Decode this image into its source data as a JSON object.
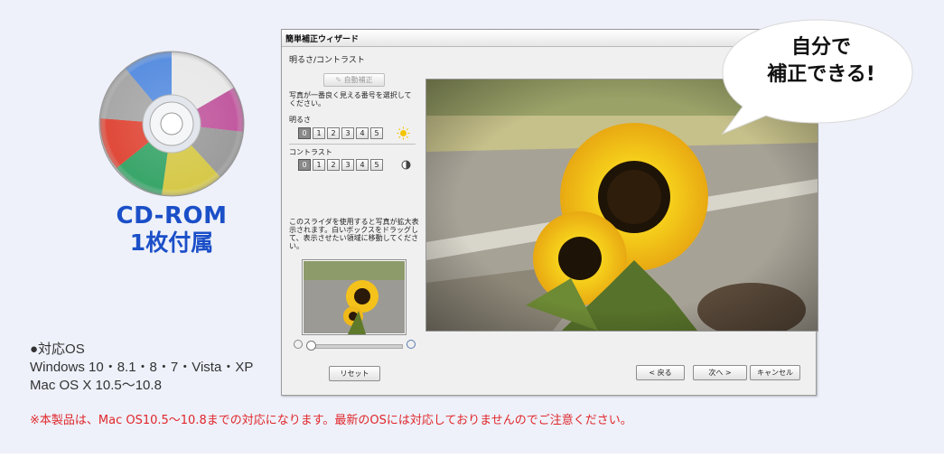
{
  "cd": {
    "line1": "CD-ROM",
    "line2": "1枚付属"
  },
  "os_info": {
    "heading": "●対応OS",
    "windows": "Windows 10・8.1・8・7・Vista・XP",
    "mac": "Mac OS X 10.5～10.8"
  },
  "notice": "※本製品は、Mac OS10.5～10.8までの対応になります。最新のOSには対応しておりませんのでご注意ください。",
  "bubble": {
    "line1": "自分で",
    "line2": "補正できる!"
  },
  "window": {
    "title": "簡単補正ウィザード",
    "section_title": "明るさ/コントラスト",
    "auto_button": "自動補正",
    "instruction": "写真が一番良く見える番号を選択してください。",
    "brightness": {
      "label": "明るさ",
      "options": [
        "0",
        "1",
        "2",
        "3",
        "4",
        "5"
      ],
      "selected": "0",
      "icon": "sun-icon"
    },
    "contrast": {
      "label": "コントラスト",
      "options": [
        "0",
        "1",
        "2",
        "3",
        "4",
        "5"
      ],
      "selected": "0",
      "icon": "contrast-icon"
    },
    "slider_help": "このスライダを使用すると写真が拡大表示されます。白いボックスをドラッグして、表示させたい領域に移動してください。",
    "zoom": {
      "level": 0
    },
    "buttons": {
      "reset": "リセット",
      "back": "< 戻る",
      "next": "次へ >",
      "cancel": "キャンセル"
    }
  },
  "colors": {
    "cd_label": "#1b4fc8",
    "notice": "#e0262a",
    "background": "#eef1fa"
  }
}
